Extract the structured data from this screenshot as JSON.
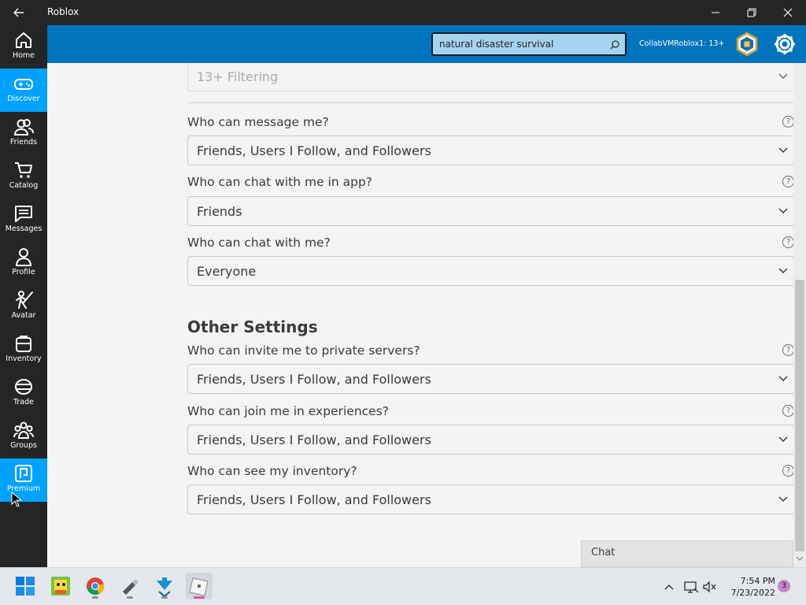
{
  "window": {
    "title": "Roblox"
  },
  "sidebar": {
    "items": [
      {
        "label": "Home",
        "icon": "home-icon",
        "active": false
      },
      {
        "label": "Discover",
        "icon": "gamepad-icon",
        "active": true
      },
      {
        "label": "Friends",
        "icon": "friends-icon",
        "active": false
      },
      {
        "label": "Catalog",
        "icon": "cart-icon",
        "active": false
      },
      {
        "label": "Messages",
        "icon": "message-icon",
        "active": false
      },
      {
        "label": "Profile",
        "icon": "profile-icon",
        "active": false
      },
      {
        "label": "Avatar",
        "icon": "avatar-icon",
        "active": false
      },
      {
        "label": "Inventory",
        "icon": "backpack-icon",
        "active": false
      },
      {
        "label": "Trade",
        "icon": "trade-icon",
        "active": false
      },
      {
        "label": "Groups",
        "icon": "groups-icon",
        "active": false
      },
      {
        "label": "Premium",
        "icon": "premium-icon",
        "active": true
      }
    ]
  },
  "header": {
    "search_value": "natural disaster survival",
    "username": "CollabVMRoblox1: 13+"
  },
  "settings": {
    "filtering_value": "13+ Filtering",
    "message_label": "Who can message me?",
    "message_value": "Friends, Users I Follow, and Followers",
    "chat_app_label": "Who can chat with me in app?",
    "chat_app_value": "Friends",
    "chat_label": "Who can chat with me?",
    "chat_value": "Everyone",
    "other_title": "Other Settings",
    "invite_label": "Who can invite me to private servers?",
    "invite_value": "Friends, Users I Follow, and Followers",
    "join_label": "Who can join me in experiences?",
    "join_value": "Friends, Users I Follow, and Followers",
    "inventory_label": "Who can see my inventory?",
    "inventory_value": "Friends, Users I Follow, and Followers",
    "help_glyph": "?"
  },
  "chat": {
    "label": "Chat"
  },
  "taskbar": {
    "time": "7:54 PM",
    "date": "7/23/2022",
    "notification_count": "3"
  }
}
